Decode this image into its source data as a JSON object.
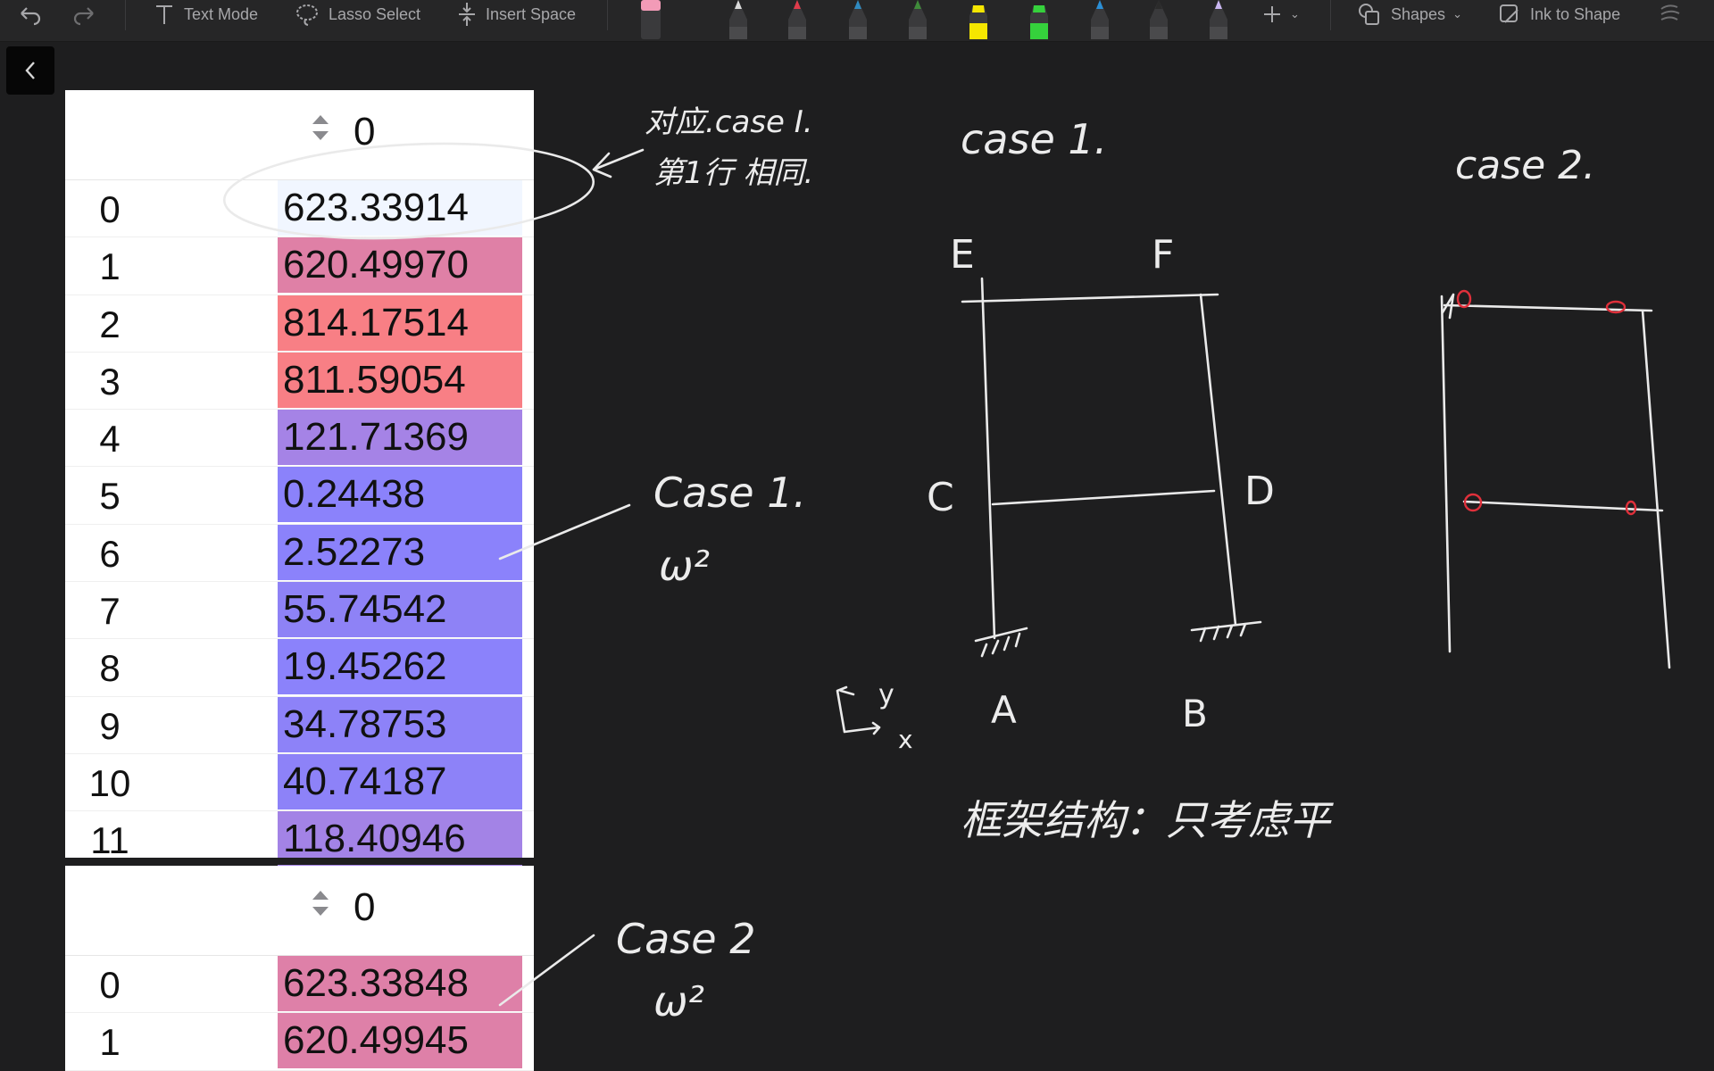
{
  "toolbar": {
    "text_mode": "Text Mode",
    "lasso_select": "Lasso Select",
    "insert_space": "Insert Space",
    "shapes": "Shapes",
    "ink_to_shape": "Ink to Shape",
    "pen_colors": [
      "#f29bb7",
      "#d9d9d9",
      "#e03b4b",
      "#2f8ac0",
      "#3f8c3a",
      "#f5e600",
      "#35d13c",
      "#2a8fd6",
      "#2b2b2b",
      "#c9b6f0"
    ]
  },
  "table1": {
    "header": "0",
    "rows": [
      {
        "index": "0",
        "value": "623.33914",
        "color": "#f1f6ff"
      },
      {
        "index": "1",
        "value": "620.49970",
        "color": "#df80a6"
      },
      {
        "index": "2",
        "value": "814.17514",
        "color": "#f87f85"
      },
      {
        "index": "3",
        "value": "811.59054",
        "color": "#f87f85"
      },
      {
        "index": "4",
        "value": "121.71369",
        "color": "#a583e6"
      },
      {
        "index": "5",
        "value": "0.24438",
        "color": "#8b82fb"
      },
      {
        "index": "6",
        "value": "2.52273",
        "color": "#8b82fb"
      },
      {
        "index": "7",
        "value": "55.74542",
        "color": "#8e82f6"
      },
      {
        "index": "8",
        "value": "19.45262",
        "color": "#8b82fb"
      },
      {
        "index": "9",
        "value": "34.78753",
        "color": "#8d82f8"
      },
      {
        "index": "10",
        "value": "40.74187",
        "color": "#8d82f8"
      },
      {
        "index": "11",
        "value": "118.40946",
        "color": "#a383e6"
      }
    ]
  },
  "table2": {
    "header": "0",
    "rows": [
      {
        "index": "0",
        "value": "623.33848",
        "color": "#de80a8"
      },
      {
        "index": "1",
        "value": "620.49945",
        "color": "#de80a8"
      }
    ]
  },
  "notes": {
    "compare": "对应.case I.",
    "compare2": "第1行 相同.",
    "case1_title": "case  1.",
    "case2_title": "case  2.",
    "case1_label": "Case 1.",
    "case1_omega": "ω²",
    "case2_label": "Case 2",
    "case2_omega": "ω²",
    "node_e": "E",
    "node_f": "F",
    "node_c": "C",
    "node_d": "D",
    "node_a": "A",
    "node_b": "B",
    "axis_y": "y",
    "axis_x": "x",
    "frame_caption": "框架结构：只考虑平"
  }
}
